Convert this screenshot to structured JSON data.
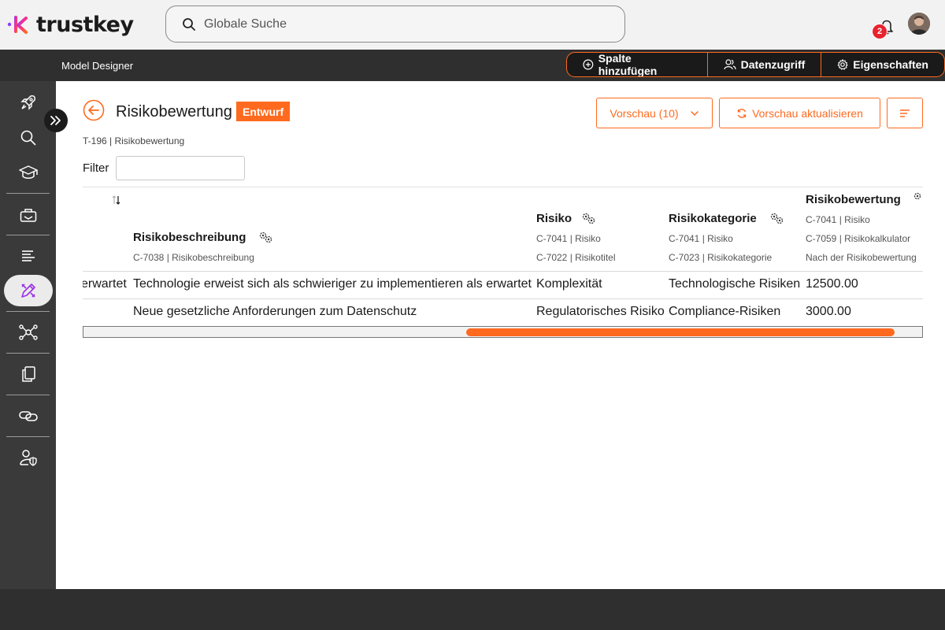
{
  "brand": {
    "name": "trustkey"
  },
  "search": {
    "placeholder": "Globale Suche"
  },
  "notifications": {
    "count": "2"
  },
  "subbar": {
    "title": "Model Designer",
    "actions": [
      "Spalte hinzufügen",
      "Datenzugriff",
      "Eigenschaften"
    ]
  },
  "page": {
    "title": "Risikobewertung",
    "status": "Entwurf",
    "breadcrumb": "T-196 | Risikobewertung",
    "filter_label": "Filter",
    "preview_label": "Vorschau (10)",
    "refresh_label": "Vorschau aktualisieren"
  },
  "table": {
    "columns": [
      {
        "title": "Risikobeschreibung",
        "subs": [
          "C-7038 | Risikobeschreibung"
        ]
      },
      {
        "title": "Risiko",
        "subs": [
          "C-7041 | Risiko",
          "C-7022 | Risikotitel"
        ]
      },
      {
        "title": "Risikokategorie",
        "subs": [
          "C-7041 | Risiko",
          "C-7023 | Risikokategorie"
        ]
      },
      {
        "title": "Risikobewertung",
        "subs": [
          "C-7041 | Risiko",
          "C-7059 | Risikokalkulator",
          "Nach der Risikobewertung"
        ]
      }
    ],
    "rows": [
      [
        "erwartet",
        "Technologie erweist sich als schwieriger zu implementieren als erwartet",
        "Komplexität",
        "Technologische Risiken",
        "12500.00"
      ],
      [
        "",
        "Neue gesetzliche Anforderungen zum Datenschutz",
        "Regulatorisches Risiko",
        "Compliance-Risiken",
        "3000.00"
      ]
    ],
    "scroll_position": 0.46
  },
  "colors": {
    "accent": "#ff6a1f",
    "badge": "#e8232f",
    "dark": "#2f2f2f",
    "sidebar": "#3a3a3a"
  },
  "sidebar_icons": [
    "rocket-icon",
    "search-icon",
    "graduation-cap-icon",
    "toolbox-icon",
    "list-icon",
    "design-tool-icon",
    "network-icon",
    "documents-icon",
    "link-icon",
    "user-shield-icon"
  ]
}
